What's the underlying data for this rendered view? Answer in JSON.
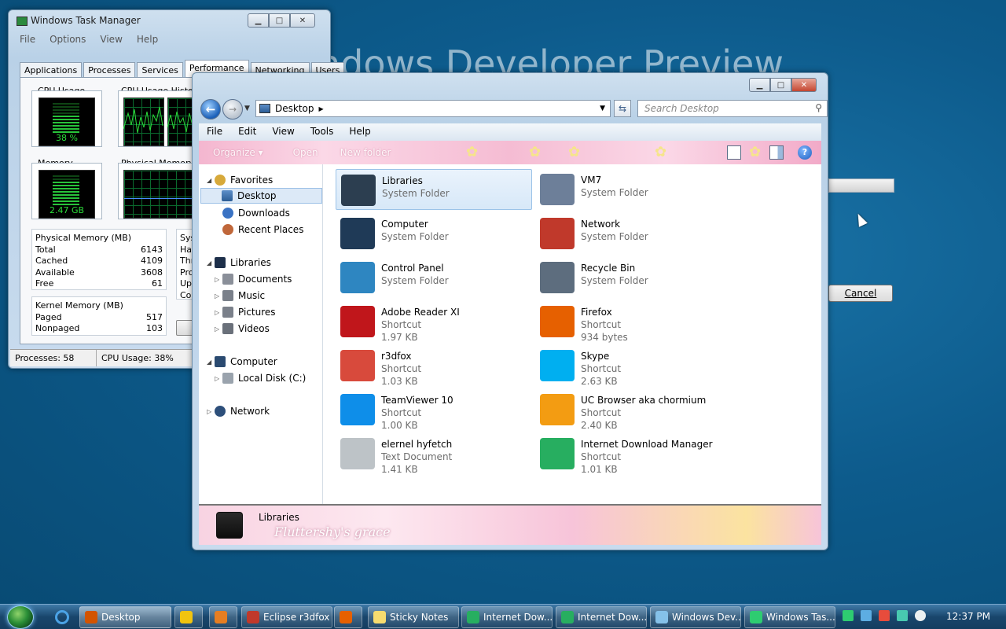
{
  "desktop": {
    "watermark": "ndows Developer Preview",
    "dialog_cancel": "Cancel"
  },
  "taskmgr": {
    "title": "Windows Task Manager",
    "menu": [
      "File",
      "Options",
      "View",
      "Help"
    ],
    "tabs": [
      "Applications",
      "Processes",
      "Services",
      "Performance",
      "Networking",
      "Users"
    ],
    "active_tab": "Performance",
    "cpu_usage_label": "CPU Usage",
    "cpu_usage_value": "38 %",
    "cpu_history_label": "CPU Usage History",
    "memory_label": "Memory",
    "memory_value": "2.47 GB",
    "phys_history_label": "Physical Memory Us",
    "physical_memory": {
      "header": "Physical Memory (MB)",
      "rows": [
        [
          "Total",
          "6143"
        ],
        [
          "Cached",
          "4109"
        ],
        [
          "Available",
          "3608"
        ],
        [
          "Free",
          "61"
        ]
      ]
    },
    "kernel_memory": {
      "header": "Kernel Memory (MB)",
      "rows": [
        [
          "Paged",
          "517"
        ],
        [
          "Nonpaged",
          "103"
        ]
      ]
    },
    "system_partial": [
      "Sys",
      "Ha",
      "Thr",
      "Pro",
      "Up",
      "Co"
    ],
    "status_processes": "Processes: 58",
    "status_cpu": "CPU Usage: 38%"
  },
  "explorer": {
    "address": "Desktop",
    "search_placeholder": "Search Desktop",
    "menu": [
      "File",
      "Edit",
      "View",
      "Tools",
      "Help"
    ],
    "commands": [
      "Organize ▾",
      "Open",
      "New folder"
    ],
    "nav": {
      "favorites": "Favorites",
      "desktop": "Desktop",
      "downloads": "Downloads",
      "recent": "Recent Places",
      "libraries": "Libraries",
      "documents": "Documents",
      "music": "Music",
      "pictures": "Pictures",
      "videos": "Videos",
      "computer": "Computer",
      "local_disk": "Local Disk (C:)",
      "network": "Network"
    },
    "items": [
      {
        "name": "Libraries",
        "type": "System Folder",
        "size": "",
        "color": "#2c3e50"
      },
      {
        "name": "VM7",
        "type": "System Folder",
        "size": "",
        "color": "#6d7f99"
      },
      {
        "name": "Computer",
        "type": "System Folder",
        "size": "",
        "color": "#1f3a57"
      },
      {
        "name": "Network",
        "type": "System Folder",
        "size": "",
        "color": "#c0392b"
      },
      {
        "name": "Control Panel",
        "type": "System Folder",
        "size": "",
        "color": "#2e86c1"
      },
      {
        "name": "Recycle Bin",
        "type": "System Folder",
        "size": "",
        "color": "#5d6d7e"
      },
      {
        "name": "Adobe Reader XI",
        "type": "Shortcut",
        "size": "1.97 KB",
        "color": "#c0161b"
      },
      {
        "name": "Firefox",
        "type": "Shortcut",
        "size": "934 bytes",
        "color": "#e66000"
      },
      {
        "name": "r3dfox",
        "type": "Shortcut",
        "size": "1.03 KB",
        "color": "#d84a3c"
      },
      {
        "name": "Skype",
        "type": "Shortcut",
        "size": "2.63 KB",
        "color": "#00aff0"
      },
      {
        "name": "TeamViewer 10",
        "type": "Shortcut",
        "size": "1.00 KB",
        "color": "#0e8ee9"
      },
      {
        "name": "UC Browser aka chormium",
        "type": "Shortcut",
        "size": "2.40 KB",
        "color": "#f39c12"
      },
      {
        "name": "elernel hyfetch",
        "type": "Text Document",
        "size": "1.41 KB",
        "color": "#bdc3c7"
      },
      {
        "name": "Internet Download Manager",
        "type": "Shortcut",
        "size": "1.01 KB",
        "color": "#27ae60"
      }
    ],
    "details_name": "Libraries",
    "details_watermark": "Fluttershy's grace"
  },
  "taskbar": {
    "buttons": [
      {
        "label": "Desktop",
        "color": "#d35400"
      },
      {
        "label": "",
        "color": "#f1c40f"
      },
      {
        "label": "",
        "color": "#e67e22"
      },
      {
        "label": "Eclipse r3dfox",
        "color": "#c0392b"
      },
      {
        "label": "",
        "color": "#e66000"
      },
      {
        "label": "Sticky Notes",
        "color": "#f7dc6f"
      },
      {
        "label": "Internet Dow...",
        "color": "#27ae60"
      },
      {
        "label": "Internet Dow...",
        "color": "#27ae60"
      },
      {
        "label": "Windows Dev...",
        "color": "#85c1e9"
      },
      {
        "label": "Windows Tas...",
        "color": "#2ecc71"
      }
    ],
    "clock": "12:37 PM"
  }
}
